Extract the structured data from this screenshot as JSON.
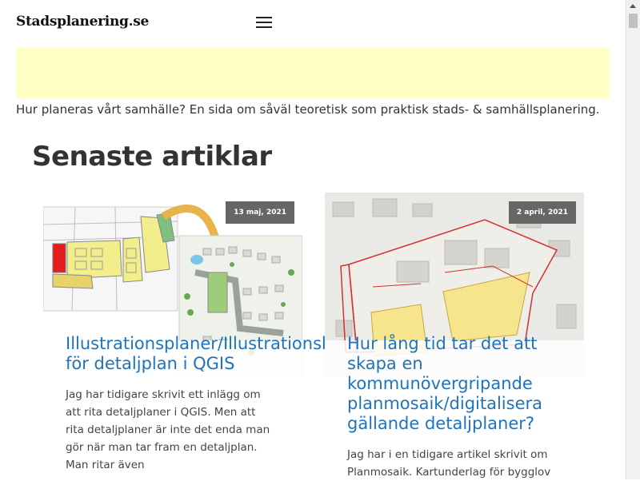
{
  "header": {
    "site_title": "Stadsplanering.se",
    "menu_icon": "hamburger-menu-icon"
  },
  "tagline": "Hur planeras vårt samhälle? En sida om såväl teoretisk som praktisk stads- & samhällsplanering.",
  "section_title": "Senaste artiklar",
  "articles": [
    {
      "date": "13 maj, 2021",
      "title": "Illustrationsplaner/Illustrationskartor\nför detaljplan i QGIS",
      "excerpt": "Jag har tidigare skrivit ett inlägg om att rita detaljplaner i QGIS. Men att rita detaljplaner är inte det enda man gör när man tar fram en detaljplan. Man ritar även"
    },
    {
      "date": "2 april, 2021",
      "title": "Hur lång tid tar det att skapa en kommunövergripande planmosaik/digitalisera gällande detaljplaner?",
      "excerpt": "Jag har i en tidigare artikel skrivit om Planmosaik. Kartunderlag för bygglov"
    }
  ],
  "colors": {
    "link": "#1e73be",
    "ad_background": "#ffffc6",
    "badge": "#666666"
  }
}
